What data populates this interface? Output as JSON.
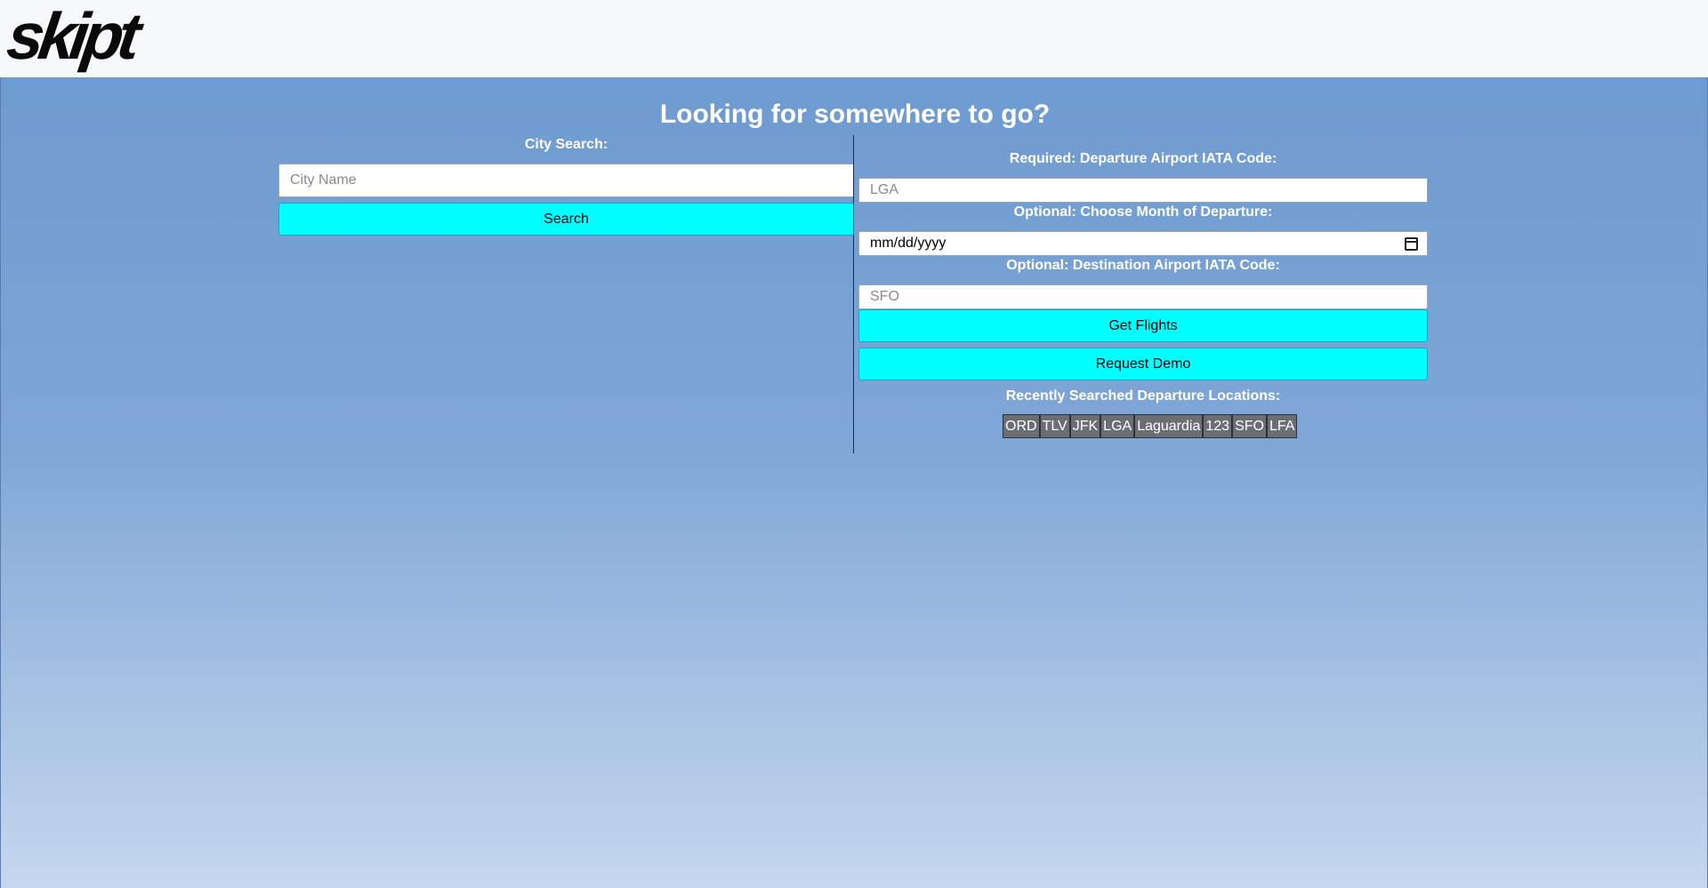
{
  "header": {
    "logo_text": "skipt"
  },
  "main": {
    "title": "Looking for somewhere to go?"
  },
  "city_search": {
    "label": "City Search:",
    "placeholder": "City Name",
    "button_label": "Search"
  },
  "flights": {
    "departure_label": "Required: Departure Airport IATA Code:",
    "departure_placeholder": "LGA",
    "month_label": "Optional: Choose Month of Departure:",
    "date_placeholder": "mm/dd/yyyy",
    "destination_label": "Optional: Destination Airport IATA Code:",
    "destination_placeholder": "SFO",
    "get_flights_label": "Get Flights",
    "request_demo_label": "Request Demo"
  },
  "recent": {
    "label": "Recently Searched Departure Locations:",
    "items": [
      "ORD",
      "TLV",
      "JFK",
      "LGA",
      "Laguardia",
      "123",
      "SFO",
      "LFA"
    ]
  },
  "colors": {
    "accent": "#00ffff",
    "background_top": "#6e9bd0",
    "background_bottom": "#c5d7ee",
    "chip": "#6b6f73"
  }
}
